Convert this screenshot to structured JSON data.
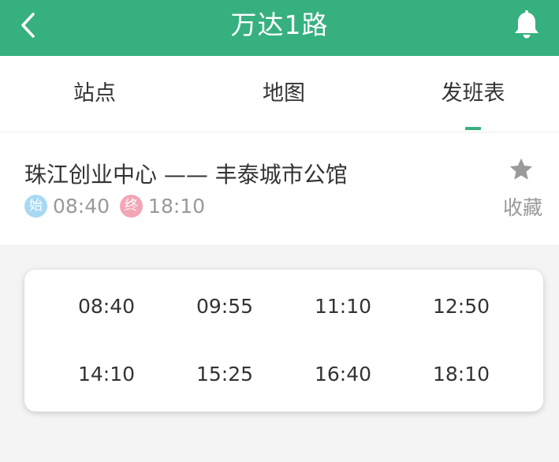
{
  "header": {
    "title": "万达1路",
    "back_icon": "chevron-left-icon",
    "bell_icon": "bell-icon",
    "background_color": "#37b07f"
  },
  "tabs": [
    {
      "label": "站点",
      "active": false
    },
    {
      "label": "地图",
      "active": false
    },
    {
      "label": "发班表",
      "active": true
    }
  ],
  "route": {
    "name": "珠江创业中心 —— 丰泰城市公馆",
    "start_badge": "始",
    "start_time": "08:40",
    "end_badge": "终",
    "end_time": "18:10",
    "start_badge_color": "#a7d9f2",
    "end_badge_color": "#f2a6b6"
  },
  "favorite": {
    "label": "收藏",
    "icon": "star-icon"
  },
  "schedule": {
    "times": [
      "08:40",
      "09:55",
      "11:10",
      "12:50",
      "14:10",
      "15:25",
      "16:40",
      "18:10"
    ]
  }
}
